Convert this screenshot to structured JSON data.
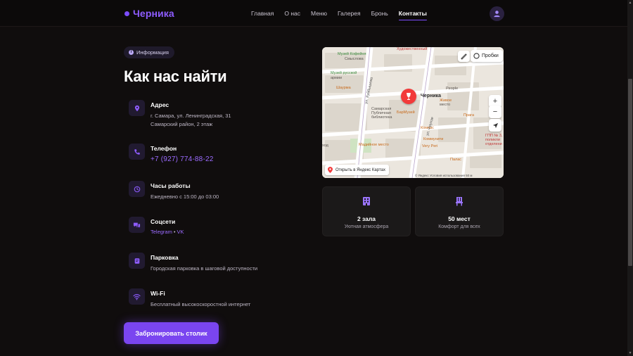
{
  "header": {
    "logo": "Черника",
    "nav": [
      "Главная",
      "О нас",
      "Меню",
      "Галерея",
      "Бронь",
      "Контакты"
    ],
    "active_nav": "Контакты"
  },
  "section": {
    "pill_icon": "i",
    "pill": "Информация",
    "title": "Как нас найти"
  },
  "info": {
    "address": {
      "label": "Адрес",
      "line1": "г. Самара, ул. Ленинградская, 31",
      "line2": "Самарский район, 2 этаж",
      "icon": "location-pin-icon"
    },
    "phone": {
      "label": "Телефон",
      "value": "+7 (927) 774-88-22",
      "icon": "phone-icon"
    },
    "hours": {
      "label": "Часы работы",
      "value": "Ежедневно с 15:00 до 03:00",
      "icon": "clock-icon"
    },
    "social": {
      "label": "Соцсети",
      "telegram": "Telegram",
      "separator": "•",
      "vk": "VK",
      "icon": "chat-icon"
    },
    "parking": {
      "label": "Парковка",
      "value": "Городская парковка в шаговой доступности",
      "icon": "parking-icon"
    },
    "wifi": {
      "label": "Wi-Fi",
      "value": "Бесплатный высокоскоростной интернет",
      "icon": "wifi-icon"
    }
  },
  "cta": {
    "label": "Забронировать столик"
  },
  "map": {
    "pin_label": "Черника",
    "traffic": "Пробки",
    "open": "Открыть в Яндекс Картах",
    "zoom_in": "+",
    "zoom_out": "−",
    "copyright": "© Яндекс   Условия использования   50 м",
    "labels": {
      "kudozhestvenny": "Художественный",
      "museum_k": "Музей Кофейня",
      "smyslova": "Смыслова",
      "museum_r": "Музей русской",
      "armii": "армии",
      "shaurma": "Шаурма",
      "library1": "Самарская",
      "library2": "Публичная",
      "library3": "библиотека",
      "barmuzey": "БарМузей",
      "ulitsa1": "ул. Куйбышева",
      "ulitsa2": "ул. Фрунзе",
      "praga": "Прага",
      "people": "People",
      "zhivoe": "Живое",
      "mesto": "место",
      "madiynoe": "Мадийное место",
      "kompas": "Компас",
      "kommunaity": "Коммунити",
      "veryperi": "Very Peri",
      "hod": "ход",
      "palas": "Палас",
      "gbu1": "ГПП № 3,",
      "gbu2": "поликли",
      "gbu3": "отделени"
    }
  },
  "stats": [
    {
      "value": "2 зала",
      "caption": "Уютная атмосфера",
      "icon": "building-icon"
    },
    {
      "value": "50 мест",
      "caption": "Комфорт для всех",
      "icon": "chair-icon"
    }
  ],
  "colors": {
    "accent": "#7c4dff",
    "background": "#100d0d",
    "pin": "#f23a3a"
  }
}
